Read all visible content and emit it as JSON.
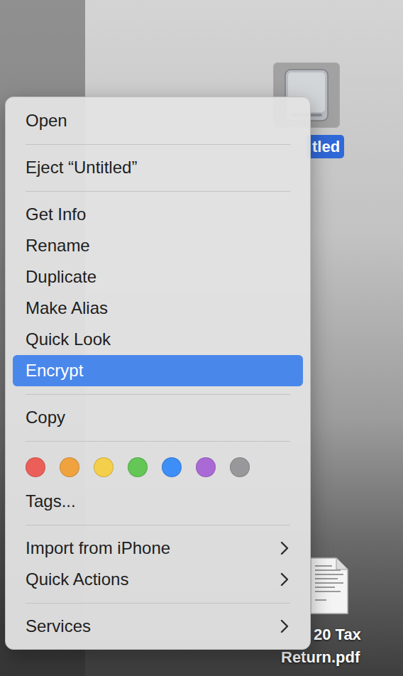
{
  "desktop_icons": [
    {
      "name": "drive",
      "label_lines": [
        "tled"
      ],
      "selected": true
    },
    {
      "name": "pdf",
      "label_lines": [
        "20 Tax",
        "Return.pdf"
      ],
      "selected": false
    }
  ],
  "context_menu": {
    "items": [
      {
        "kind": "item",
        "label": "Open",
        "selected": false,
        "submenu": false
      },
      {
        "kind": "separator"
      },
      {
        "kind": "item",
        "label": "Eject “Untitled”",
        "selected": false,
        "submenu": false
      },
      {
        "kind": "separator"
      },
      {
        "kind": "item",
        "label": "Get Info",
        "selected": false,
        "submenu": false
      },
      {
        "kind": "item",
        "label": "Rename",
        "selected": false,
        "submenu": false
      },
      {
        "kind": "item",
        "label": "Duplicate",
        "selected": false,
        "submenu": false
      },
      {
        "kind": "item",
        "label": "Make Alias",
        "selected": false,
        "submenu": false
      },
      {
        "kind": "item",
        "label": "Quick Look",
        "selected": false,
        "submenu": false
      },
      {
        "kind": "item",
        "label": "Encrypt",
        "selected": true,
        "submenu": false
      },
      {
        "kind": "separator"
      },
      {
        "kind": "item",
        "label": "Copy",
        "selected": false,
        "submenu": false
      },
      {
        "kind": "separator"
      },
      {
        "kind": "colors",
        "colors": [
          {
            "color": "#ec5f59"
          },
          {
            "color": "#f0a23f"
          },
          {
            "color": "#f4cf4b"
          },
          {
            "color": "#63c656"
          },
          {
            "color": "#3d8ef6"
          },
          {
            "color": "#aa6ad6"
          },
          {
            "color": "#98989b"
          }
        ]
      },
      {
        "kind": "item",
        "label": "Tags...",
        "selected": false,
        "submenu": false
      },
      {
        "kind": "separator"
      },
      {
        "kind": "item",
        "label": "Import from iPhone",
        "selected": false,
        "submenu": true
      },
      {
        "kind": "item",
        "label": "Quick Actions",
        "selected": false,
        "submenu": true
      },
      {
        "kind": "separator"
      },
      {
        "kind": "item",
        "label": "Services",
        "selected": false,
        "submenu": true
      }
    ]
  }
}
